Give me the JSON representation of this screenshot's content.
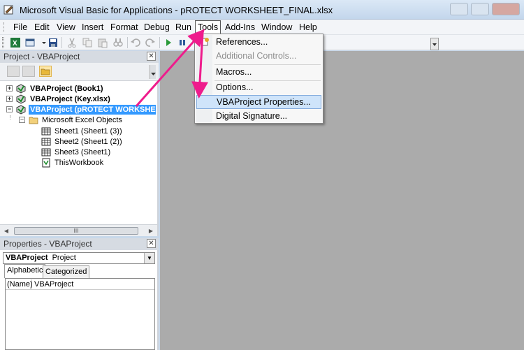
{
  "window": {
    "title": "Microsoft Visual Basic for Applications - pROTECT WORKSHEET_FINAL.xlsx"
  },
  "menubar": {
    "items": [
      "File",
      "Edit",
      "View",
      "Insert",
      "Format",
      "Debug",
      "Run",
      "Tools",
      "Add-Ins",
      "Window",
      "Help"
    ],
    "active": "Tools"
  },
  "tools_menu": {
    "items": [
      {
        "label": "References...",
        "enabled": true
      },
      {
        "label": "Additional Controls...",
        "enabled": false
      },
      {
        "label": "Macros...",
        "enabled": true
      },
      {
        "label": "Options...",
        "enabled": true
      },
      {
        "label": "VBAProject Properties...",
        "enabled": true,
        "highlighted": true
      },
      {
        "label": "Digital Signature...",
        "enabled": true
      }
    ]
  },
  "project_pane": {
    "title": "Project - VBAProject",
    "tree": [
      {
        "label": "VBAProject (Book1)",
        "bold": true,
        "expander": "+"
      },
      {
        "label": "VBAProject (Key.xlsx)",
        "bold": true,
        "expander": "+"
      },
      {
        "label": "VBAProject (pROTECT WORKSHEET_F",
        "bold": true,
        "expander": "−",
        "selected": true
      },
      {
        "label": "Microsoft Excel Objects",
        "bold": false,
        "expander": "−"
      },
      {
        "label": "Sheet1 (Sheet1 (3))",
        "bold": false
      },
      {
        "label": "Sheet2 (Sheet1 (2))",
        "bold": false
      },
      {
        "label": "Sheet3 (Sheet1)",
        "bold": false
      },
      {
        "label": "ThisWorkbook",
        "bold": false
      }
    ],
    "scroll_thumb": "III"
  },
  "properties_pane": {
    "title": "Properties - VBAProject",
    "object_name": "VBAProject",
    "object_type": "Project",
    "tabs": [
      "Alphabetic",
      "Categorized"
    ],
    "active_tab": "Alphabetic",
    "rows": [
      {
        "name": "(Name)",
        "value": "VBAProject"
      }
    ]
  },
  "colors": {
    "annotation_arrow": "#ee1c8c",
    "selection": "#3399ff",
    "menu_highlight": "#cfe4fa",
    "workspace": "#ababab"
  }
}
